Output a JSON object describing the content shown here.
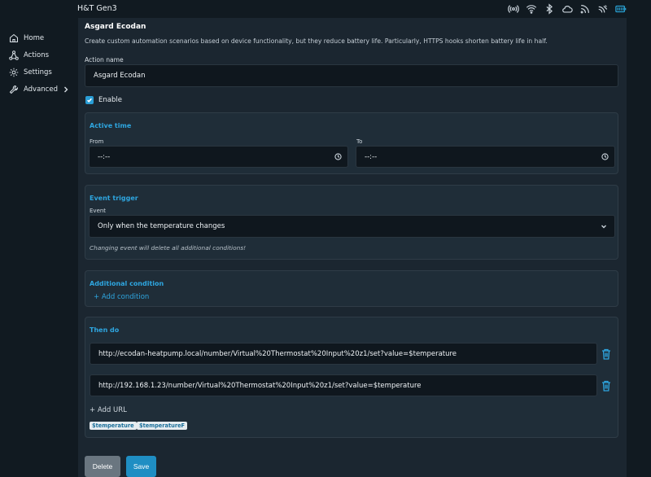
{
  "app": {
    "title": "H&T Gen3"
  },
  "status_icons": [
    "broadcast-icon",
    "wifi-icon",
    "bluetooth-icon",
    "cloud-icon",
    "rss-icon",
    "signal-icon",
    "battery-icon"
  ],
  "sidebar": {
    "items": [
      {
        "label": "Home",
        "icon": "home-icon"
      },
      {
        "label": "Actions",
        "icon": "actions-icon"
      },
      {
        "label": "Settings",
        "icon": "gear-icon"
      },
      {
        "label": "Advanced",
        "icon": "wrench-icon"
      }
    ]
  },
  "form": {
    "heading": "Asgard Ecodan",
    "description": "Create custom automation scenarios based on device functionality, but they reduce battery life. Particularly, HTTPS hooks shorten battery life in half.",
    "action_name_label": "Action name",
    "action_name_value": "Asgard Ecodan",
    "enable_label": "Enable",
    "enable_checked": true
  },
  "active_time": {
    "title": "Active time",
    "from_label": "From",
    "from_value": "--:--",
    "to_label": "To",
    "to_value": "--:--"
  },
  "event_trigger": {
    "title": "Event trigger",
    "event_label": "Event",
    "event_value": "Only when the temperature changes",
    "hint": "Changing event will delete all additional conditions!"
  },
  "additional_condition": {
    "title": "Additional condition",
    "add_label": "+ Add condition"
  },
  "then_do": {
    "title": "Then do",
    "urls": [
      "http://ecodan-heatpump.local/number/Virtual%20Thermostat%20Input%20z1/set?value=$temperature",
      "http://192.168.1.23/number/Virtual%20Thermostat%20Input%20z1/set?value=$temperature"
    ],
    "add_url_label": "+ Add URL",
    "tags": [
      "$temperature",
      "$temperatureF"
    ]
  },
  "buttons": {
    "delete": "Delete",
    "save": "Save"
  },
  "colors": {
    "accent": "#2ea6e0",
    "background": "#111a21",
    "panel": "#1f2d38",
    "input": "#0f171e"
  }
}
